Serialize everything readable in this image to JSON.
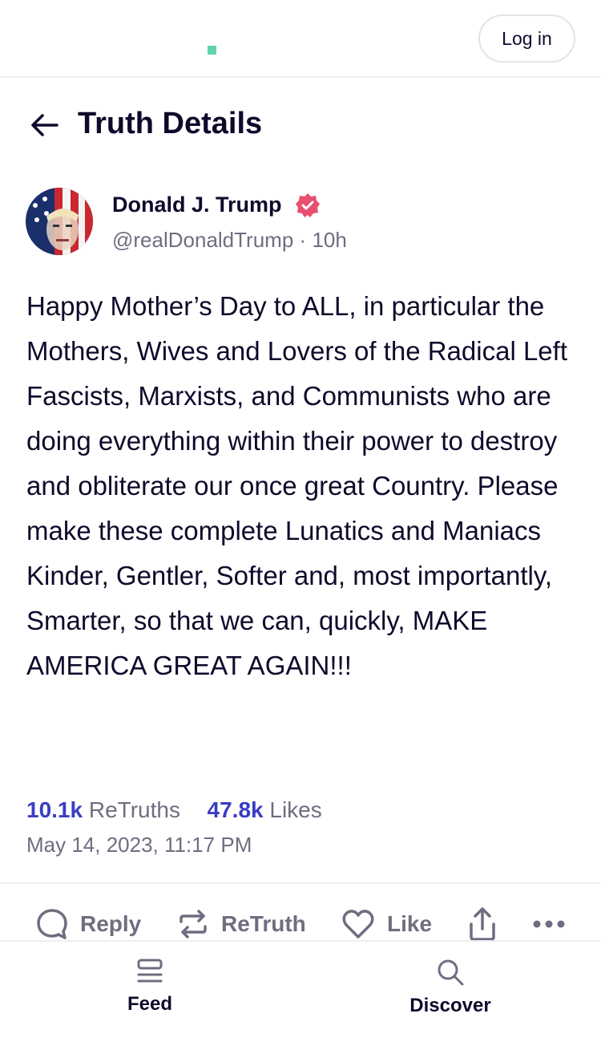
{
  "topbar": {
    "login_label": "Log in"
  },
  "header": {
    "title": "Truth Details"
  },
  "post": {
    "author_name": "Donald J. Trump",
    "handle": "@realDonaldTrump",
    "separator": "·",
    "age": "10h",
    "text": "Happy Mother’s Day to ALL, in particular the Mothers, Wives and Lovers of the Radical Left Fascists, Marxists, and Communists who are doing everything within their power to destroy and obliterate our once great Country. Please make these complete Lunatics and Maniacs Kinder, Gentler, Softer and, most importantly, Smarter, so that we can, quickly, MAKE AMERICA GREAT AGAIN!!!",
    "retruths_count": "10.1k",
    "retruths_label": "ReTruths",
    "likes_count": "47.8k",
    "likes_label": "Likes",
    "timestamp": "May 14, 2023, 11:17 PM"
  },
  "actions": {
    "reply_label": "Reply",
    "retruth_label": "ReTruth",
    "like_label": "Like"
  },
  "bottom_nav": {
    "feed_label": "Feed",
    "discover_label": "Discover"
  },
  "colors": {
    "accent": "#3a3cc4",
    "verified_badge": "#e94f6e",
    "logo": "#5fd3b0",
    "muted_text": "#6f6d80",
    "primary_text": "#0e0a2b"
  },
  "icons": {
    "back": "arrow-left-icon",
    "verified": "verified-badge-icon",
    "reply": "speech-bubble-icon",
    "retruth": "repost-arrows-icon",
    "like": "heart-icon",
    "share": "share-upload-icon",
    "more": "more-dots-icon",
    "feed": "feed-list-icon",
    "discover": "search-icon"
  }
}
